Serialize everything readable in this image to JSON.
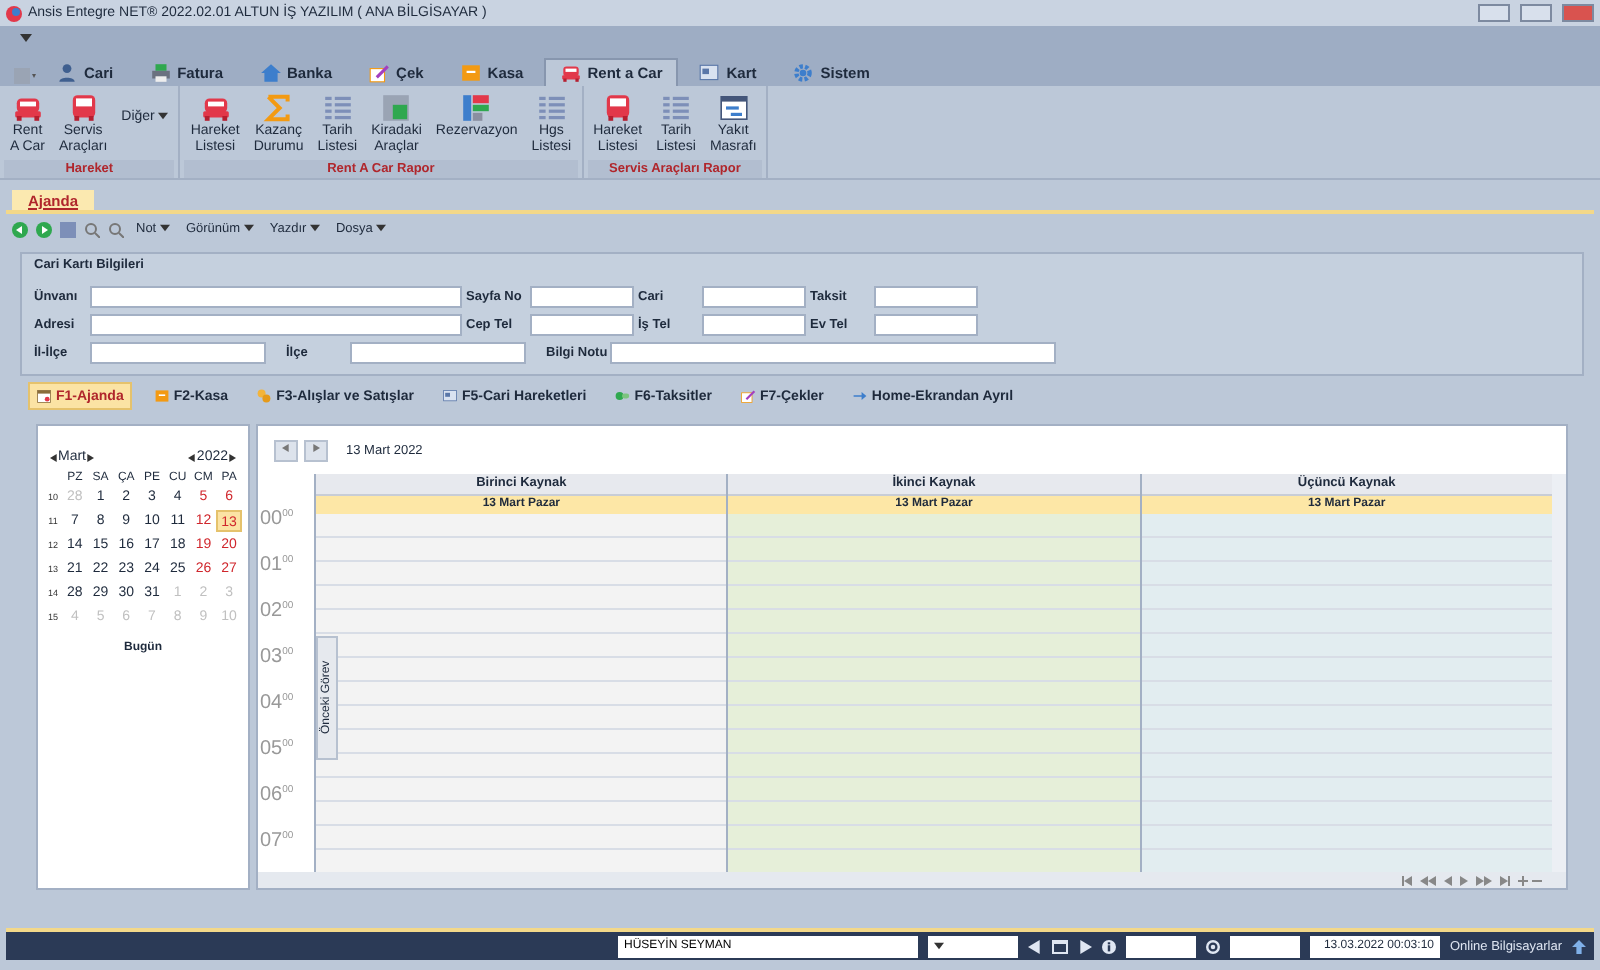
{
  "window": {
    "title": "Ansis Entegre NET® 2022.02.01 ALTUN İŞ YAZILIM ( ANA BİLGİSAYAR )"
  },
  "ribbon_tabs": [
    {
      "label": "Cari",
      "kind": "person",
      "selected": false
    },
    {
      "label": "Fatura",
      "kind": "printer",
      "selected": false
    },
    {
      "label": "Banka",
      "kind": "house",
      "selected": false
    },
    {
      "label": "Çek",
      "kind": "pen",
      "selected": false
    },
    {
      "label": "Kasa",
      "kind": "box",
      "selected": false
    },
    {
      "label": "Rent a Car",
      "kind": "car",
      "selected": true
    },
    {
      "label": "Kart",
      "kind": "card",
      "selected": false
    },
    {
      "label": "Sistem",
      "kind": "gear",
      "selected": false
    }
  ],
  "ribbon_groups": [
    {
      "label": "Hareket",
      "items": [
        {
          "label": "Rent\nA Car",
          "kind": "car"
        },
        {
          "label": "Servis\nAraçları",
          "kind": "bus"
        },
        {
          "label": "Diğer",
          "kind": "dropdown"
        }
      ]
    },
    {
      "label": "Rent A Car Rapor",
      "items": [
        {
          "label": "Hareket\nListesi",
          "kind": "car"
        },
        {
          "label": "Kazanç\nDurumu",
          "kind": "sigma"
        },
        {
          "label": "Tarih\nListesi",
          "kind": "list"
        },
        {
          "label": "Kiradaki\nAraçlar",
          "kind": "grid"
        },
        {
          "label": "Rezervazyon",
          "kind": "board"
        },
        {
          "label": "Hgs\nListesi",
          "kind": "list"
        }
      ]
    },
    {
      "label": "Servis Araçları Rapor",
      "items": [
        {
          "label": "Hareket\nListesi",
          "kind": "bus"
        },
        {
          "label": "Tarih\nListesi",
          "kind": "list"
        },
        {
          "label": "Yakıt\nMasrafı",
          "kind": "window"
        }
      ]
    }
  ],
  "document_tab": {
    "label": "Ajanda",
    "selected": true
  },
  "toolbar": {
    "menus": [
      "Not",
      "Görünüm",
      "Yazdır",
      "Dosya"
    ]
  },
  "form": {
    "title": "Cari Kartı Bilgileri",
    "rows": [
      [
        {
          "label": "Ünvanı"
        },
        {
          "label": "Sayfa No"
        },
        {
          "label": "Cari"
        },
        {
          "label": "Taksit"
        }
      ],
      [
        {
          "label": "Adresi"
        },
        {
          "label": "Cep Tel"
        },
        {
          "label": "İş Tel"
        },
        {
          "label": "Ev Tel"
        }
      ],
      [
        {
          "label": "İl-İlçe"
        },
        {
          "label": "İlçe"
        },
        {
          "label": "Bilgi Notu"
        }
      ]
    ]
  },
  "section_tabs": [
    {
      "label": "F1-Ajanda",
      "kind": "calendar",
      "selected": true
    },
    {
      "label": "F2-Kasa",
      "kind": "box",
      "selected": false
    },
    {
      "label": "F3-Alışlar ve Satışlar",
      "kind": "coins",
      "selected": false
    },
    {
      "label": "F5-Cari Hareketleri",
      "kind": "card",
      "selected": false
    },
    {
      "label": "F6-Taksitler",
      "kind": "pills",
      "selected": false
    },
    {
      "label": "F7-Çekler",
      "kind": "pen",
      "selected": false
    },
    {
      "label": "Home-Ekrandan Ayrıl",
      "kind": "arrow",
      "selected": false
    }
  ],
  "mini_calendar": {
    "month": "Mart",
    "year": "2022",
    "weekdays": [
      "PZ",
      "SA",
      "ÇA",
      "PE",
      "CU",
      "CM",
      "PA"
    ],
    "today_label": "Bugün",
    "weeks": [
      {
        "week": "10",
        "days": [
          {
            "day": "28",
            "kind": "muted",
            "selected": false
          },
          {
            "day": "1",
            "kind": "normal",
            "selected": false
          },
          {
            "day": "2",
            "kind": "normal",
            "selected": false
          },
          {
            "day": "3",
            "kind": "normal",
            "selected": false
          },
          {
            "day": "4",
            "kind": "normal",
            "selected": false
          },
          {
            "day": "5",
            "kind": "weekend",
            "selected": false
          },
          {
            "day": "6",
            "kind": "weekend",
            "selected": false
          }
        ]
      },
      {
        "week": "11",
        "days": [
          {
            "day": "7",
            "kind": "normal",
            "selected": false
          },
          {
            "day": "8",
            "kind": "normal",
            "selected": false
          },
          {
            "day": "9",
            "kind": "normal",
            "selected": false
          },
          {
            "day": "10",
            "kind": "normal",
            "selected": false
          },
          {
            "day": "11",
            "kind": "normal",
            "selected": false
          },
          {
            "day": "12",
            "kind": "weekend",
            "selected": false
          },
          {
            "day": "13",
            "kind": "weekend",
            "selected": true
          }
        ]
      },
      {
        "week": "12",
        "days": [
          {
            "day": "14",
            "kind": "normal",
            "selected": false
          },
          {
            "day": "15",
            "kind": "normal",
            "selected": false
          },
          {
            "day": "16",
            "kind": "normal",
            "selected": false
          },
          {
            "day": "17",
            "kind": "normal",
            "selected": false
          },
          {
            "day": "18",
            "kind": "normal",
            "selected": false
          },
          {
            "day": "19",
            "kind": "weekend",
            "selected": false
          },
          {
            "day": "20",
            "kind": "weekend",
            "selected": false
          }
        ]
      },
      {
        "week": "13",
        "days": [
          {
            "day": "21",
            "kind": "normal",
            "selected": false
          },
          {
            "day": "22",
            "kind": "normal",
            "selected": false
          },
          {
            "day": "23",
            "kind": "normal",
            "selected": false
          },
          {
            "day": "24",
            "kind": "normal",
            "selected": false
          },
          {
            "day": "25",
            "kind": "normal",
            "selected": false
          },
          {
            "day": "26",
            "kind": "weekend",
            "selected": false
          },
          {
            "day": "27",
            "kind": "weekend",
            "selected": false
          }
        ]
      },
      {
        "week": "14",
        "days": [
          {
            "day": "28",
            "kind": "normal",
            "selected": false
          },
          {
            "day": "29",
            "kind": "normal",
            "selected": false
          },
          {
            "day": "30",
            "kind": "normal",
            "selected": false
          },
          {
            "day": "31",
            "kind": "normal",
            "selected": false
          },
          {
            "day": "1",
            "kind": "muted",
            "selected": false
          },
          {
            "day": "2",
            "kind": "muted",
            "selected": false
          },
          {
            "day": "3",
            "kind": "muted",
            "selected": false
          }
        ]
      },
      {
        "week": "15",
        "days": [
          {
            "day": "4",
            "kind": "muted",
            "selected": false
          },
          {
            "day": "5",
            "kind": "muted",
            "selected": false
          },
          {
            "day": "6",
            "kind": "muted",
            "selected": false
          },
          {
            "day": "7",
            "kind": "muted",
            "selected": false
          },
          {
            "day": "8",
            "kind": "muted",
            "selected": false
          },
          {
            "day": "9",
            "kind": "muted",
            "selected": false
          },
          {
            "day": "10",
            "kind": "muted",
            "selected": false
          }
        ]
      }
    ]
  },
  "scheduler": {
    "date": "13 Mart 2022",
    "side_tab": "Önceki Görev",
    "resources": [
      {
        "name": "Birinci Kaynak",
        "day": "13 Mart Pazar",
        "color": "#f3f3f3"
      },
      {
        "name": "İkinci Kaynak",
        "day": "13 Mart Pazar",
        "color": "#e6efd9"
      },
      {
        "name": "Üçüncü Kaynak",
        "day": "13 Mart Pazar",
        "color": "#e2edf0"
      }
    ],
    "hours": [
      {
        "hour": "00",
        "minutes": "00"
      },
      {
        "hour": "01",
        "minutes": "00"
      },
      {
        "hour": "02",
        "minutes": "00"
      },
      {
        "hour": "03",
        "minutes": "00"
      },
      {
        "hour": "04",
        "minutes": "00"
      },
      {
        "hour": "05",
        "minutes": "00"
      },
      {
        "hour": "06",
        "minutes": "00"
      },
      {
        "hour": "07",
        "minutes": "00"
      }
    ]
  },
  "status_bar": {
    "user": "HÜSEYİN SEYMAN",
    "datetime": "13.03.2022  00:03:10",
    "online": "Online Bilgisayarlar"
  }
}
